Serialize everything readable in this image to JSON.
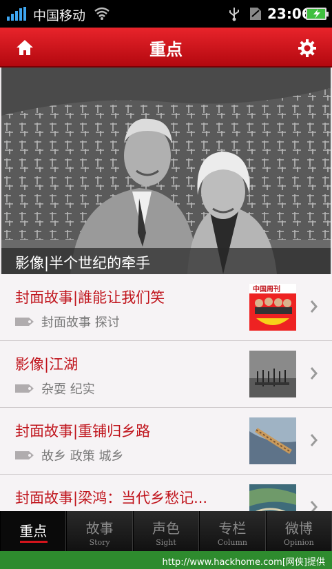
{
  "status_bar": {
    "carrier": "中国移动",
    "time": "23:06",
    "icons": [
      "signal-icon",
      "wifi-icon",
      "usb-icon",
      "sd-card-icon",
      "battery-charging-icon"
    ]
  },
  "header": {
    "title": "重点",
    "left_icon": "home-icon",
    "right_icon": "gear-icon"
  },
  "hero": {
    "caption": "影像|半个世纪的牵手"
  },
  "articles": [
    {
      "title": "封面故事|誰能让我们笑",
      "tags": "封面故事 探讨",
      "thumb": "magazine-cover"
    },
    {
      "title": "影像|江湖",
      "tags": "杂耍 纪实",
      "thumb": "photo-street"
    },
    {
      "title": "封面故事|重铺归乡路",
      "tags": "故乡 政策 城乡",
      "thumb": "photo-river"
    },
    {
      "title": "封面故事|梁鸿：当代乡愁记...",
      "tags": "",
      "thumb": "photo-aerial"
    }
  ],
  "tabs": [
    {
      "cn": "重点",
      "en": ""
    },
    {
      "cn": "故事",
      "en": "Story"
    },
    {
      "cn": "声色",
      "en": "Sight"
    },
    {
      "cn": "专栏",
      "en": "Column"
    },
    {
      "cn": "微博",
      "en": "Opinion"
    }
  ],
  "active_tab": 0,
  "watermark": "http://www.hackhome.com[网侠]提供",
  "colors": {
    "accent": "#c0141c",
    "header": "#d01820",
    "tabbar": "#1a1a1a"
  }
}
